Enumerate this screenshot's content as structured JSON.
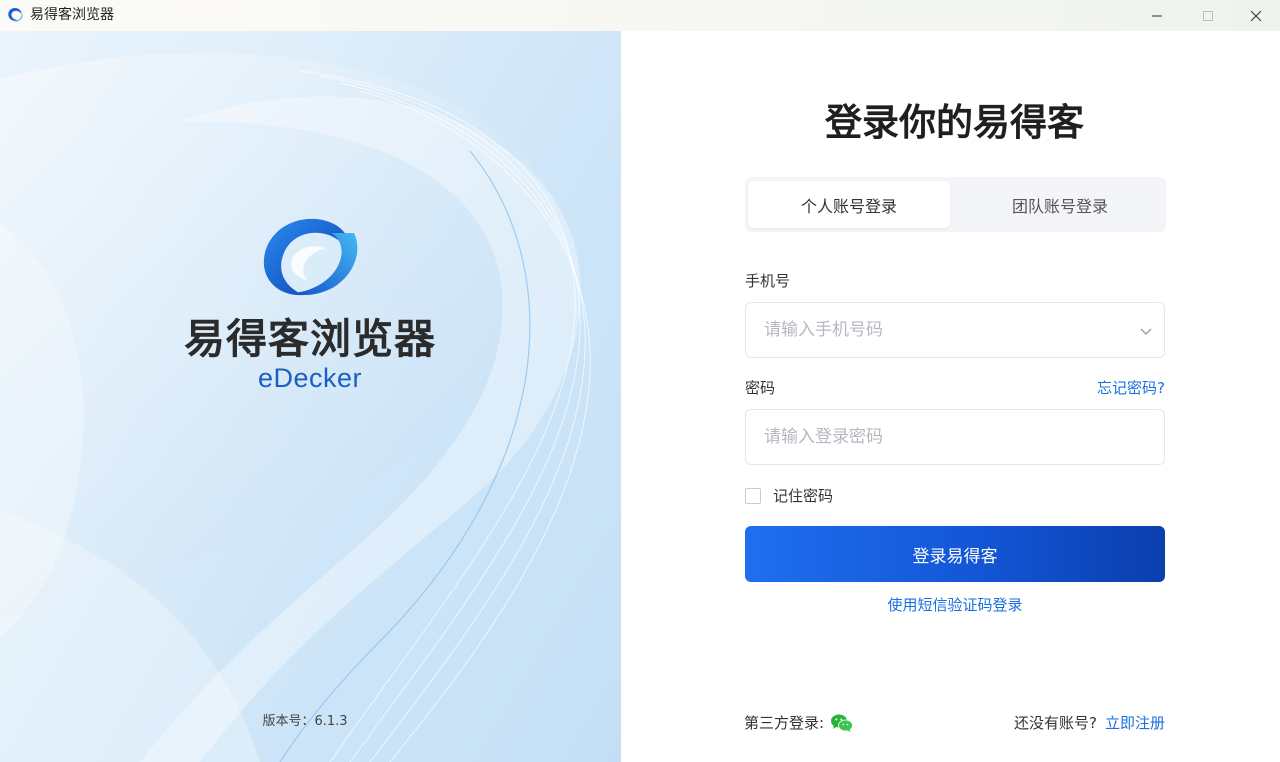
{
  "window": {
    "title": "易得客浏览器",
    "minimize_icon": "minimize-icon",
    "maximize_icon": "maximize-icon",
    "close_icon": "close-icon"
  },
  "brand": {
    "logo_icon": "edecker-logo",
    "name_cn": "易得客浏览器",
    "name_en": "eDecker",
    "version": "版本号：6.1.3"
  },
  "login": {
    "title": "登录你的易得客",
    "tabs": [
      {
        "label": "个人账号登录",
        "active": true
      },
      {
        "label": "团队账号登录",
        "active": false
      }
    ],
    "phone": {
      "label": "手机号",
      "placeholder": "请输入手机号码",
      "value": ""
    },
    "password": {
      "label": "密码",
      "placeholder": "请输入登录密码",
      "value": "",
      "forgot": "忘记密码?"
    },
    "remember": {
      "label": "记住密码",
      "checked": false
    },
    "submit_label": "登录易得客",
    "sms_link": "使用短信验证码登录",
    "third_party_label": "第三方登录:",
    "third_party_icon": "wechat-icon",
    "no_account": "还没有账号?",
    "register_link": "立即注册"
  },
  "colors": {
    "accent": "#1a6fe0",
    "button_start": "#1f6ff0",
    "button_end": "#0a3fae",
    "brand_blue": "#1a5fc1"
  }
}
